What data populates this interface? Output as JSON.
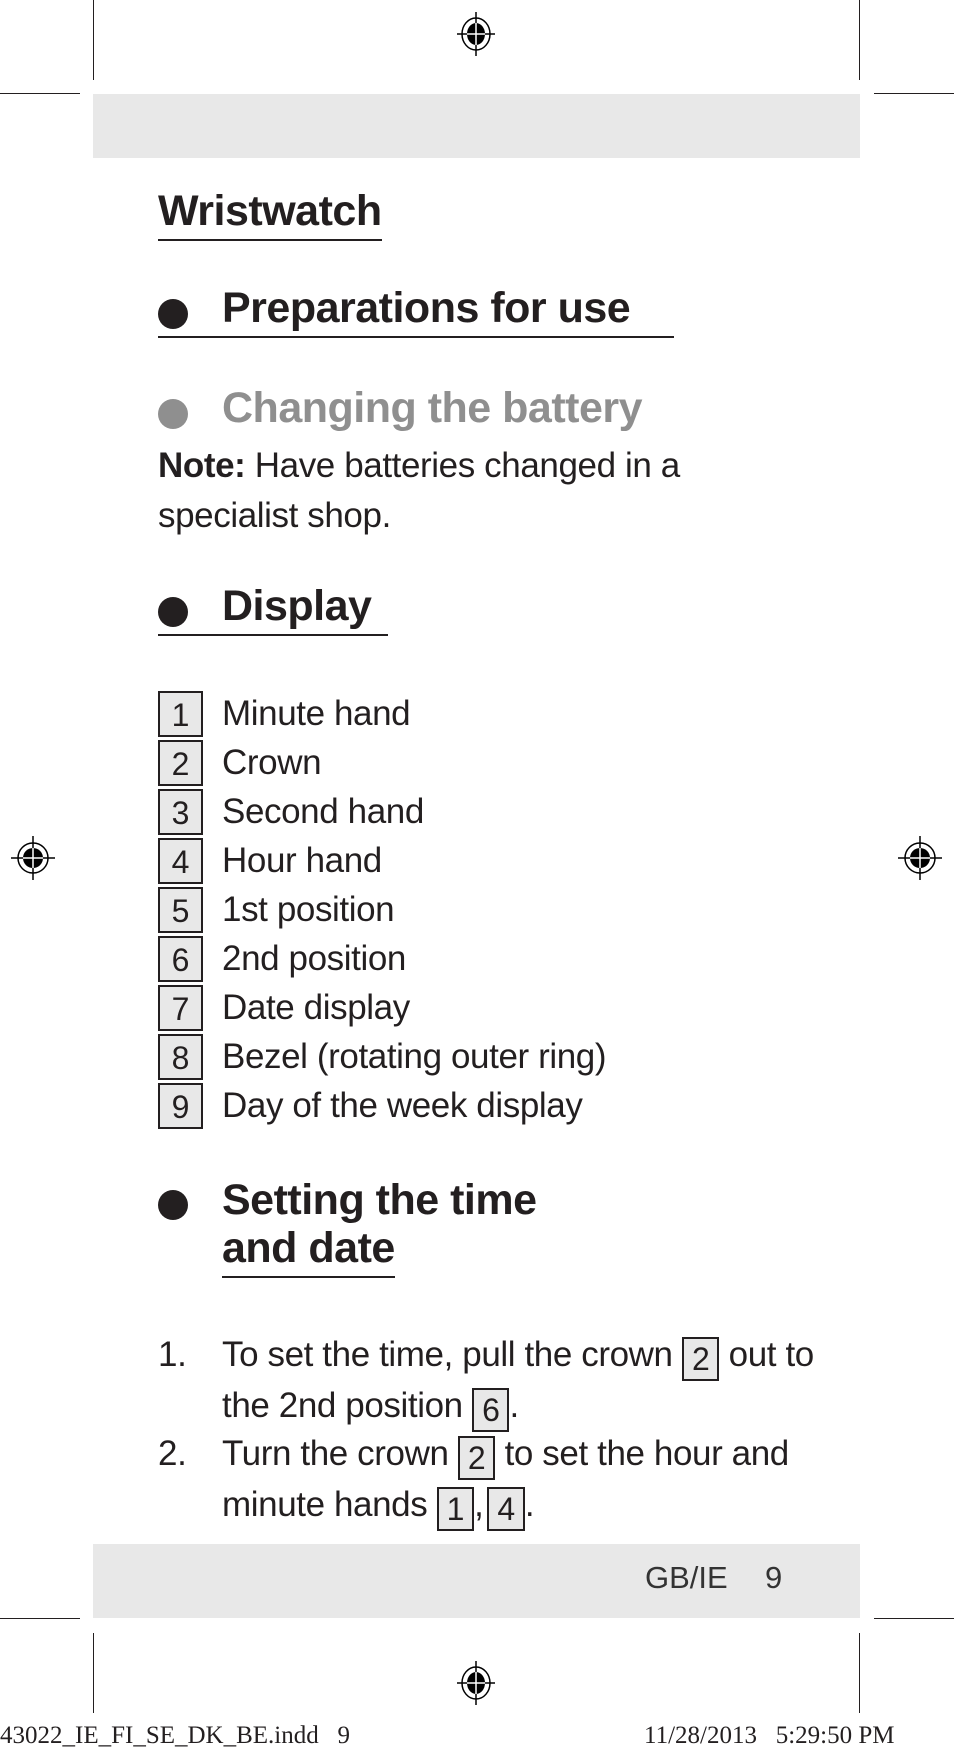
{
  "document": {
    "title": "Wristwatch",
    "sections": {
      "preparations": {
        "heading": "Preparations for use"
      },
      "battery": {
        "heading": "Changing the battery",
        "note_label": "Note:",
        "note_text": " Have batteries changed in a",
        "note_text_line2": "specialist shop."
      },
      "display": {
        "heading": "Display",
        "items": [
          {
            "num": "1",
            "label": "Minute hand"
          },
          {
            "num": "2",
            "label": "Crown"
          },
          {
            "num": "3",
            "label": "Second hand"
          },
          {
            "num": "4",
            "label": "Hour hand"
          },
          {
            "num": "5",
            "label": "1st position"
          },
          {
            "num": "6",
            "label": "2nd position"
          },
          {
            "num": "7",
            "label": "Date display"
          },
          {
            "num": "8",
            "label": "Bezel (rotating outer ring)"
          },
          {
            "num": "9",
            "label": "Day of the week display"
          }
        ]
      },
      "setting": {
        "heading_line1": "Setting the time",
        "heading_line2": "and date",
        "steps": [
          {
            "num": "1.",
            "line1_a": "To set the time, pull the crown ",
            "ref1": "2",
            "line1_b": " out to",
            "line2_a": "the 2nd position ",
            "ref2": "6",
            "line2_b": "."
          },
          {
            "num": "2.",
            "line1_a": "Turn the crown ",
            "ref1": "2",
            "line1_b": " to set the hour and",
            "line2_a": "minute hands ",
            "ref2": "1",
            "sep": ",",
            "ref3": "4",
            "line2_b": "."
          }
        ]
      }
    },
    "footer": {
      "region": "GB/IE",
      "page_number": "9"
    },
    "slug": {
      "filename": "43022_IE_FI_SE_DK_BE.indd   9",
      "timestamp": "11/28/2013   5:29:50 PM"
    }
  },
  "icons": {
    "registration_mark": "registration-mark-icon",
    "bullet": "bullet-icon"
  },
  "colors": {
    "text": "#231f20",
    "grey_heading": "#8f8f8f",
    "band": "#e8e8e8"
  }
}
